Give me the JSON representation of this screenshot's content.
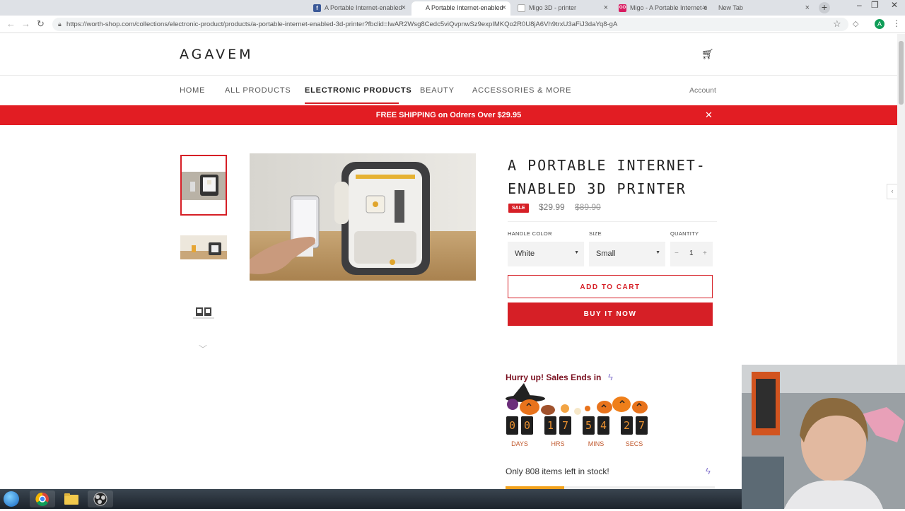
{
  "browser": {
    "tabs": [
      {
        "title": "A Portable Internet-enabled",
        "favicon": "facebook-icon",
        "color": "#3b5998",
        "active": false
      },
      {
        "title": "A Portable Internet-enabled",
        "favicon": "shop-icon",
        "color": "#ffffff",
        "active": true
      },
      {
        "title": "Migo 3D - printer",
        "favicon": "doc-icon",
        "color": "#9aa0a6",
        "active": false
      },
      {
        "title": "Migo - A Portable Internet-e",
        "favicon": "gogo-icon",
        "color": "#d81b60",
        "active": false
      },
      {
        "title": "New Tab",
        "favicon": "",
        "color": "",
        "active": false
      }
    ],
    "url": "https://worth-shop.com/collections/electronic-product/products/a-portable-internet-enabled-3d-printer?fbclid=IwAR2Wsg8Cedc5viQvpnwSz9expIMKQo2R0U8jA6Vh9trxU3aFiJ3daYq8-gA",
    "profile_initial": "A"
  },
  "store": {
    "logo": "AGAVEM",
    "nav": [
      "HOME",
      "ALL PRODUCTS",
      "ELECTRONIC PRODUCTS",
      "BEAUTY",
      "ACCESSORIES & MORE"
    ],
    "nav_active": "ELECTRONIC PRODUCTS",
    "account": "Account",
    "banner": "FREE SHIPPING on Odrers Over $29.95",
    "accent": "#e21d23"
  },
  "product": {
    "title": "A PORTABLE INTERNET-ENABLED 3D PRINTER",
    "sale_badge": "SALE",
    "price": "$29.99",
    "compare_price": "$89.90",
    "options": {
      "color_label": "HANDLE COLOR",
      "color_value": "White",
      "size_label": "SIZE",
      "size_value": "Small",
      "qty_label": "QUANTITY",
      "qty_value": "1",
      "minus": "−",
      "plus": "+"
    },
    "add_to_cart": "ADD TO CART",
    "buy_now": "BUY IT NOW"
  },
  "promo": {
    "hurry": "Hurry up! Sales Ends in",
    "countdown": {
      "days": [
        "0",
        "0"
      ],
      "hrs": [
        "1",
        "7"
      ],
      "mins": [
        "5",
        "4"
      ],
      "secs": [
        "2",
        "7"
      ]
    },
    "units": [
      "DAYS",
      "HRS",
      "MINS",
      "SECS"
    ],
    "stock_text": "Only 808 items left in stock!",
    "stock_fill_fraction": 0.28
  },
  "taskbar": {
    "apps": [
      "windows-start-icon",
      "chrome-icon",
      "file-explorer-icon",
      "obs-icon"
    ]
  }
}
